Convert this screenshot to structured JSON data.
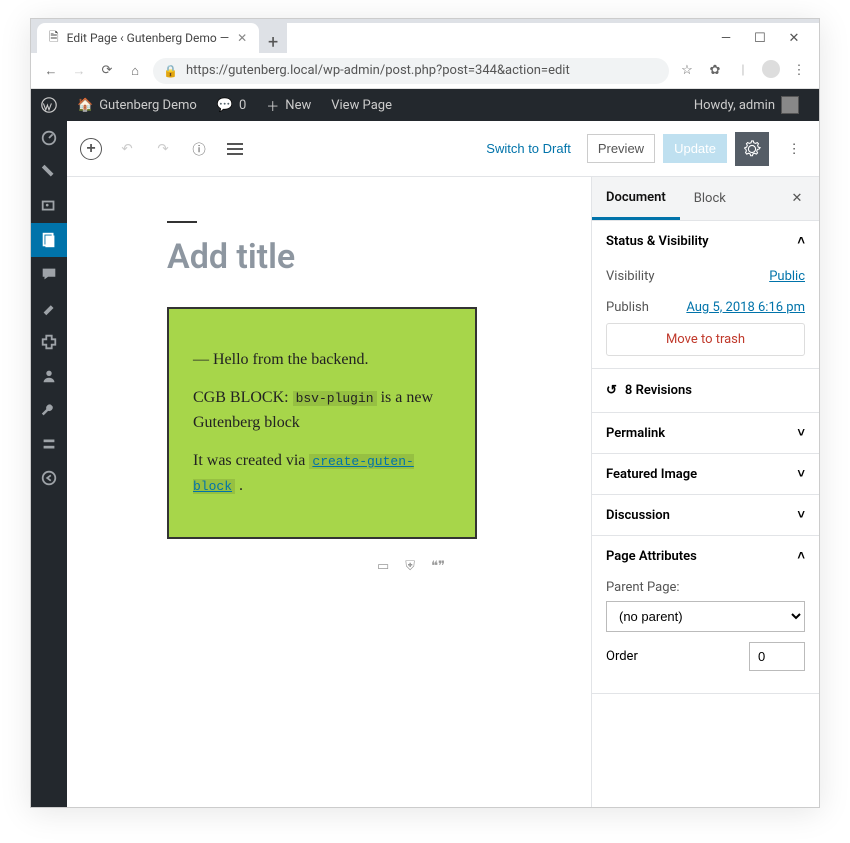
{
  "browser": {
    "tab_title": "Edit Page ‹ Gutenberg Demo —",
    "url": "https://gutenberg.local/wp-admin/post.php?post=344&action=edit"
  },
  "wpbar": {
    "site_title": "Gutenberg Demo",
    "comments_count": "0",
    "new_label": "New",
    "view_label": "View Page",
    "howdy": "Howdy, admin"
  },
  "editor_toolbar": {
    "switch_label": "Switch to Draft",
    "preview_label": "Preview",
    "update_label": "Update"
  },
  "title_placeholder": "Add title",
  "block": {
    "line1": "— Hello from the backend.",
    "prefix": "CGB BLOCK:",
    "code1": "bsv-plugin",
    "line2_tail": "is a new Gutenberg block",
    "line3_head": "It was created via",
    "code2": "create-guten-block",
    "line3_tail": "."
  },
  "inspector": {
    "tab_document": "Document",
    "tab_block": "Block",
    "status_title": "Status & Visibility",
    "visibility_label": "Visibility",
    "visibility_value": "Public",
    "publish_label": "Publish",
    "publish_value": "Aug 5, 2018 6:16 pm",
    "trash_label": "Move to trash",
    "revisions_count": "8 Revisions",
    "permalink_title": "Permalink",
    "featured_title": "Featured Image",
    "discussion_title": "Discussion",
    "page_attr_title": "Page Attributes",
    "parent_label": "Parent Page:",
    "parent_value": "(no parent)",
    "order_label": "Order",
    "order_value": "0"
  }
}
